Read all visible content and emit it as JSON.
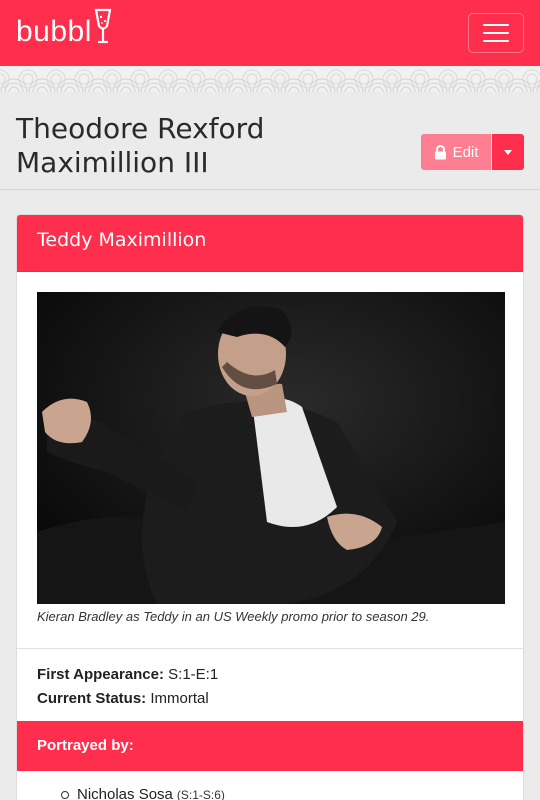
{
  "navbar": {
    "brand": "bubbl",
    "brand_icon": "champagne-glass-icon",
    "menu_icon": "hamburger-menu-icon",
    "color": "#ff2e4d"
  },
  "page": {
    "title": "Theodore Rexford Maximillion III",
    "edit_label": "Edit",
    "edit_icon": "lock-icon",
    "edit_color": "#ff7e92"
  },
  "card": {
    "title": "Teddy Maximillion",
    "image_caption": "Kieran Bradley as Teddy in an US Weekly promo prior to season 29.",
    "facts": [
      {
        "label": "First Appearance:",
        "value": "S:1-E:1"
      },
      {
        "label": "Current Status:",
        "value": "Immortal"
      }
    ],
    "portrayed_heading": "Portrayed by:",
    "portrayals": [
      {
        "name": "Nicholas Sosa",
        "range": "(S:1-S:6)"
      }
    ]
  }
}
